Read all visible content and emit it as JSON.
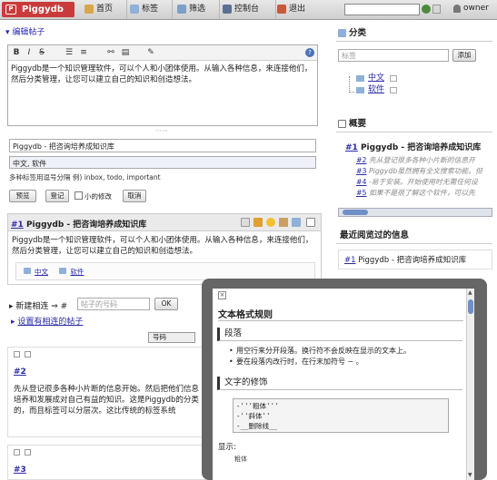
{
  "app": {
    "name": "Piggydb",
    "user": "owner"
  },
  "nav": {
    "home": "首页",
    "tags": "标签",
    "filter": "筛选",
    "control": "控制台",
    "logout": "退出"
  },
  "editor": {
    "header": "编辑帖子",
    "content": "Piggydb是一个知识管理软件，可以个人和小团体使用。从输入各种信息，来连接他们，然后分类管理，让您可以建立自己的知识和创造想法。",
    "title_value": "Piggydb - 把咨询培养成知识库",
    "tags_value": "中文, 软件",
    "tags_hint": "多种标签用逗号分隔  例) inbox, todo, important",
    "preview_label": "预览",
    "register_label": "登记",
    "minor_label": "小的修改",
    "cancel_label": "取消"
  },
  "fragment": {
    "number": "#1",
    "title": "Piggydb - 把咨询培养成知识库",
    "body": "Piggydb是一个知识管理软件，可以个人和小团体使用。从输入各种信息，来连接他们，然后分类管理，让您可以建立自己的知识和创造想法。",
    "tags": [
      "中文",
      "软件"
    ]
  },
  "relations": {
    "new_label": "新建相连",
    "hash": "#",
    "number_placeholder": "帖子的号码",
    "ok_label": "OK",
    "set_label": "设置有相连的帖子",
    "sort_value": "号码"
  },
  "fragment2": {
    "number": "#2",
    "text": "先从登记很多各种小片断的信息开始。然后把他们信息培养和发展成对自己有益的知识。这是Piggydb的分类的，而且标签可以分层次。这比传统的标签系统"
  },
  "fragment3": {
    "number": "#3"
  },
  "categories": {
    "title": "分类",
    "input_placeholder": "标签",
    "add_label": "添加",
    "items": [
      "中文",
      "软件"
    ]
  },
  "summary": {
    "title": "概要",
    "main_number": "#1",
    "main_title": "Piggydb - 把咨询培养成知识库",
    "items": [
      {
        "num": "#2",
        "text": "先从登记很多各种小片断的信息开"
      },
      {
        "num": "#3",
        "text": "Piggydb虽然拥有全文搜索功能。但"
      },
      {
        "num": "#4",
        "text": "-易于安装。开始使用时无需任何设"
      },
      {
        "num": "#5",
        "text": "如果不是很了解这个软件，可以先"
      }
    ]
  },
  "recent": {
    "title": "最近阅览过的信息",
    "number": "#1",
    "title_text": "Piggydb - 把咨询培养成知识库"
  },
  "dialog": {
    "close": "×",
    "title": "文本格式规则",
    "sec1": "段落",
    "bullets": [
      "用空行来分开段落。换行符不会反映在显示的文本上。",
      "要在段落内改行时，在行末加符号 ~ 。"
    ],
    "sec2": "文字的修饰",
    "code": [
      "-'''粗体'''",
      "-''斜体''",
      "-__删除线__"
    ],
    "display_label": "显示:",
    "more": "粗体"
  },
  "colors": {
    "accent": "#2a2aa8",
    "logo": "#c93b3b",
    "overlay": "#666666"
  }
}
